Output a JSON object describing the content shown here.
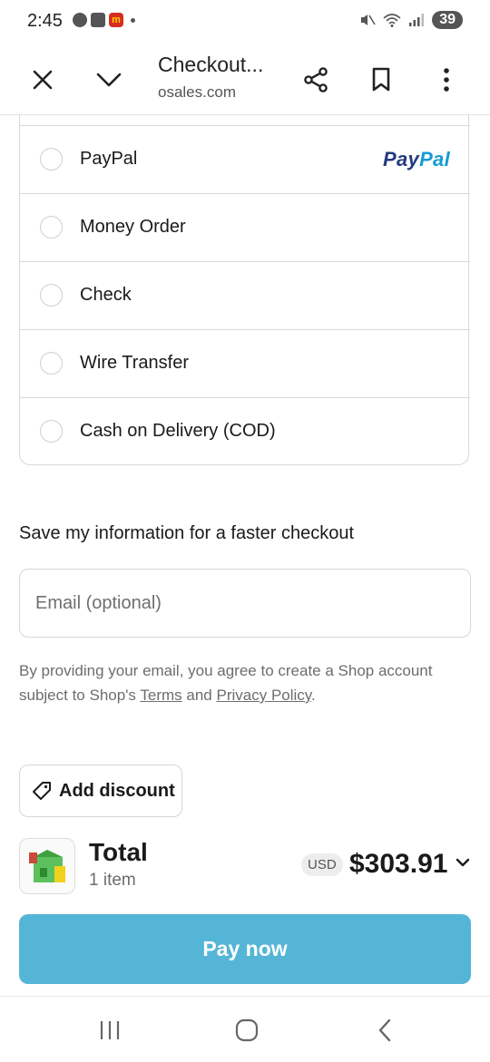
{
  "status_bar": {
    "time": "2:45",
    "battery": "39"
  },
  "toolbar": {
    "title": "Checkout...",
    "url": "osales.com"
  },
  "payment_methods": [
    {
      "label": "PayPal",
      "brand": "PayPal"
    },
    {
      "label": "Money Order"
    },
    {
      "label": "Check"
    },
    {
      "label": "Wire Transfer"
    },
    {
      "label": "Cash on Delivery (COD)"
    }
  ],
  "save_info": {
    "title": "Save my information for a faster checkout",
    "email_placeholder": "Email (optional)",
    "terms_prefix": "By providing your email, you agree to create a Shop account subject to Shop's",
    "terms_link": "Terms",
    "terms_and": "and",
    "privacy_link": "Privacy Policy",
    "terms_suffix": "."
  },
  "discount": {
    "label": "Add discount"
  },
  "summary": {
    "total_label": "Total",
    "items": "1 item",
    "currency": "USD",
    "amount": "$303.91"
  },
  "pay_button": {
    "label": "Pay now"
  },
  "colors": {
    "accent": "#55b5d7",
    "paypal_dark": "#253b80",
    "paypal_light": "#179bd7"
  }
}
